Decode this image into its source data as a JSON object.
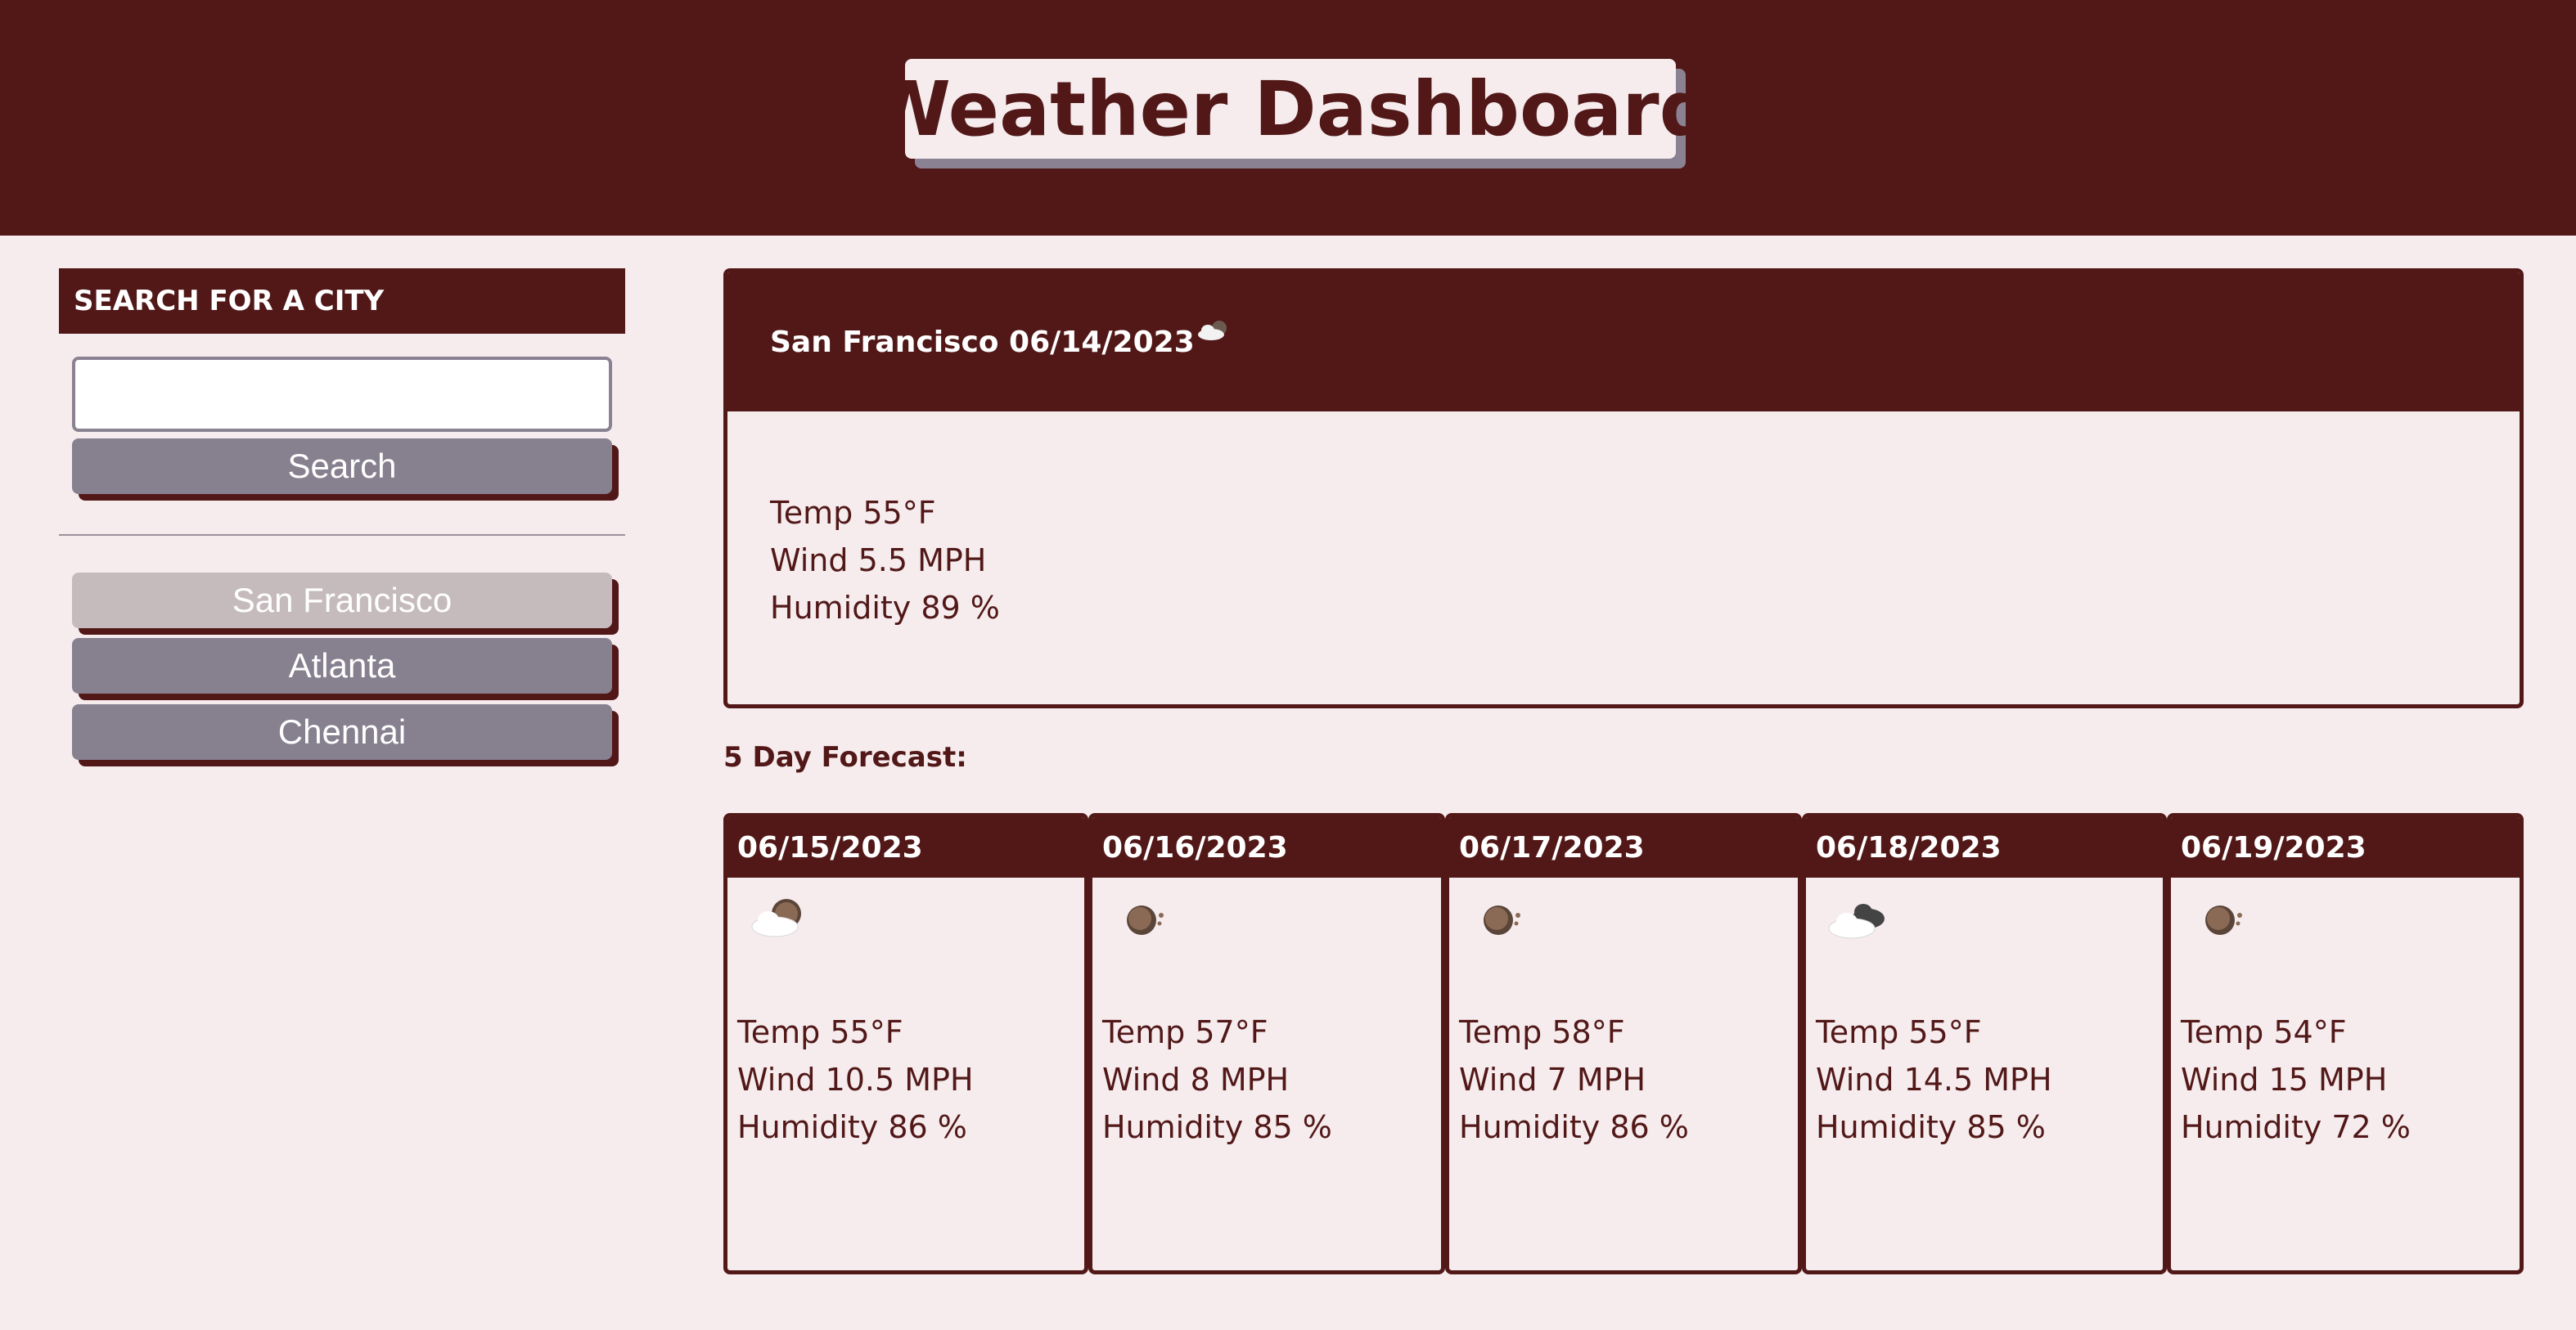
{
  "header": {
    "title": "Weather Dashboard"
  },
  "sidebar": {
    "search_heading": "SEARCH FOR A CITY",
    "search_input_value": "",
    "search_button_label": "Search",
    "history": [
      {
        "label": "San Francisco",
        "active": true
      },
      {
        "label": "Atlanta",
        "active": false
      },
      {
        "label": "Chennai",
        "active": false
      }
    ]
  },
  "current": {
    "heading": "San Francisco 06/14/2023",
    "icon": "partly-cloudy-icon",
    "temp": "Temp 55°F",
    "wind": "Wind 5.5 MPH",
    "humidity": "Humidity 89 %"
  },
  "forecast": {
    "title": "5 Day Forecast:",
    "days": [
      {
        "date": "06/15/2023",
        "icon": "partly-cloudy-icon",
        "temp": "Temp 55°F",
        "wind": "Wind 10.5 MPH",
        "humidity": "Humidity 86 %"
      },
      {
        "date": "06/16/2023",
        "icon": "clear-night-icon",
        "temp": "Temp 57°F",
        "wind": "Wind 8 MPH",
        "humidity": "Humidity 85 %"
      },
      {
        "date": "06/17/2023",
        "icon": "clear-night-icon",
        "temp": "Temp 58°F",
        "wind": "Wind 7 MPH",
        "humidity": "Humidity 86 %"
      },
      {
        "date": "06/18/2023",
        "icon": "cloudy-night-icon",
        "temp": "Temp 55°F",
        "wind": "Wind 14.5 MPH",
        "humidity": "Humidity 85 %"
      },
      {
        "date": "06/19/2023",
        "icon": "clear-night-icon",
        "temp": "Temp 54°F",
        "wind": "Wind 15 MPH",
        "humidity": "Humidity 72 %"
      }
    ]
  },
  "colors": {
    "primary": "#521818",
    "background": "#f6ecee",
    "button": "#86808f",
    "button_active": "#c5bbbd"
  }
}
